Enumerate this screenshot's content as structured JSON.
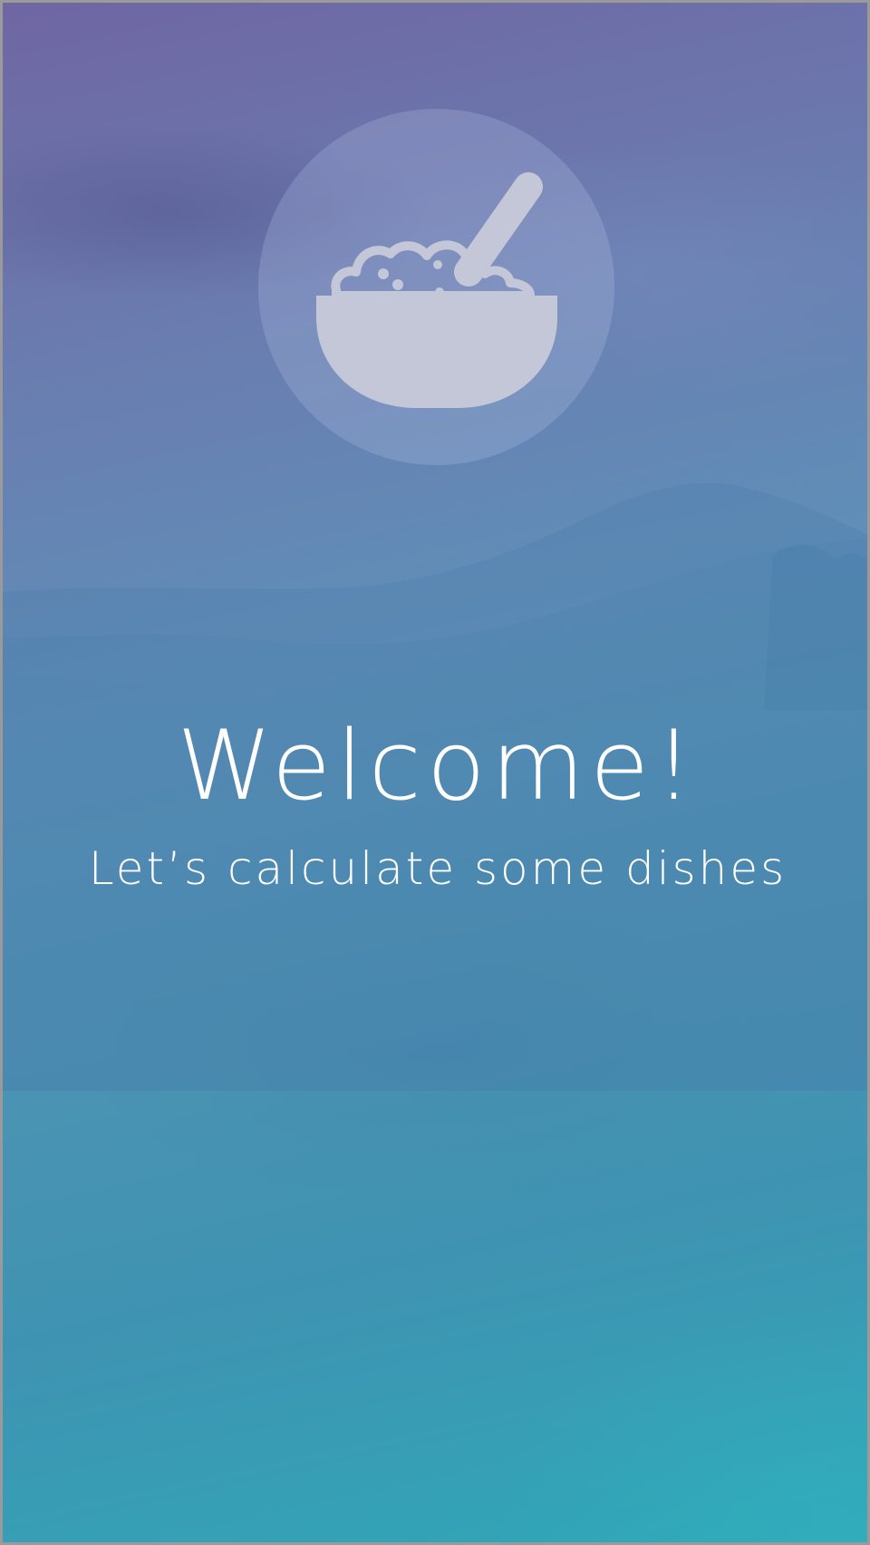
{
  "screen": {
    "title": "Welcome!",
    "subtitle": "Let’s calculate some dishes"
  },
  "logo": {
    "icon": "bowl-with-spoon-icon",
    "color": "#c3c7d8"
  },
  "colors": {
    "gradient_top": "#6f66a3",
    "gradient_bottom": "#2fa8b8",
    "text": "#ffffff"
  }
}
